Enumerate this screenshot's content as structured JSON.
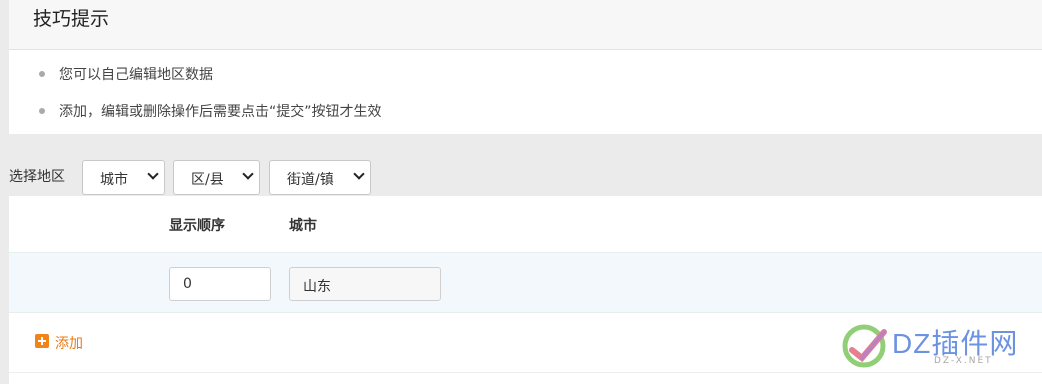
{
  "tips": {
    "title": "技巧提示",
    "items": [
      "您可以自己编辑地区数据",
      "添加，编辑或删除操作后需要点击“提交”按钮才生效"
    ]
  },
  "region": {
    "label": "选择地区",
    "city_select": "城市",
    "district_select": "区/县",
    "street_select": "街道/镇"
  },
  "table": {
    "headers": {
      "order": "显示顺序",
      "city": "城市"
    },
    "rows": [
      {
        "order": "0",
        "city": "山东"
      }
    ]
  },
  "actions": {
    "add_label": "添加"
  },
  "watermark": {
    "text": "DZ插件网",
    "sub": "DZ-X.NET"
  },
  "colors": {
    "accent_orange": "#f08418",
    "watermark_blue": "#3a6fd8",
    "row_highlight": "#f2f8fb"
  }
}
